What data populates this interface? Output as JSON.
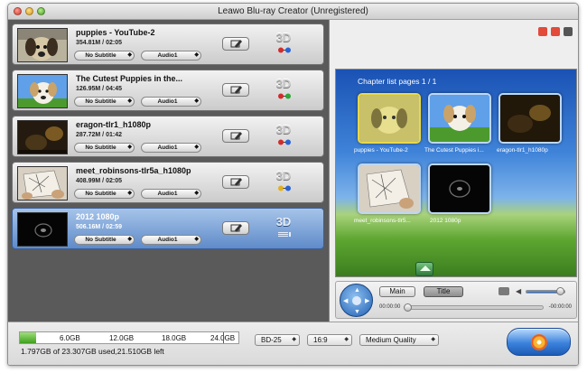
{
  "window": {
    "title": "Leawo Blu-ray Creator (Unregistered)"
  },
  "videos": [
    {
      "title": "puppies - YouTube-2",
      "meta": "354.81M / 02:05",
      "subtitle": "No Subtitle",
      "audio": "Audio1",
      "three_d": "3D",
      "selected": false
    },
    {
      "title": "The Cutest Puppies in the...",
      "meta": "126.95M / 04:45",
      "subtitle": "No Subtitle",
      "audio": "Audio1",
      "three_d": "3D",
      "selected": false
    },
    {
      "title": "eragon-tlr1_h1080p",
      "meta": "287.72M / 01:42",
      "subtitle": "No Subtitle",
      "audio": "Audio1",
      "three_d": "3D",
      "selected": false
    },
    {
      "title": "meet_robinsons-tlr5a_h1080p",
      "meta": "408.99M / 02:05",
      "subtitle": "No Subtitle",
      "audio": "Audio1",
      "three_d": "3D",
      "selected": false
    },
    {
      "title": "2012 1080p",
      "meta": "506.16M / 02:59",
      "subtitle": "No Subtitle",
      "audio": "Audio1",
      "three_d": "3D",
      "selected": true
    }
  ],
  "preview": {
    "chapter_header": "Chapter list pages 1 / 1",
    "chapters": [
      "puppies - YouTube-2",
      "The Cutest Puppies i...",
      "eragon-tlr1_h1080p",
      "meet_robinsons-tlr5...",
      "2012 1080p"
    ]
  },
  "player": {
    "main_label": "Main",
    "title_label": "Title",
    "time_current": "00:00:00",
    "time_remaining": "-00:00:00",
    "progress_fraction": 0.0,
    "volume_fraction": 0.9
  },
  "capacity": {
    "ticks": [
      "6.0GB",
      "12.0GB",
      "18.0GB",
      "24.0GB"
    ],
    "used_fraction": 0.075,
    "mark_fraction": 0.93,
    "usage_text": "1.797GB of 23.307GB used,21.510GB left"
  },
  "options": {
    "disc_type": "BD-25",
    "aspect": "16:9",
    "quality": "Medium Quality"
  },
  "colors": {
    "accent_blue": "#3b82dc",
    "selected_row": "#7ea4d9",
    "capacity_fill": "#5fbf33"
  },
  "icons": {
    "edit": "pencil-edit-icon",
    "glasses": "3d-glasses-icon",
    "burn": "burn-disc-icon"
  }
}
